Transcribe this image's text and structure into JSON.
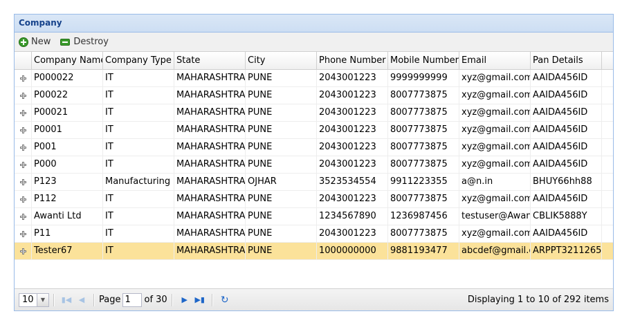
{
  "panel": {
    "title": "Company"
  },
  "toolbar": {
    "new_label": "New",
    "destroy_label": "Destroy"
  },
  "grid": {
    "columns": [
      "Company Name",
      "Company Type",
      "State",
      "City",
      "Phone Number",
      "Mobile Number",
      "Email",
      "Pan Details"
    ],
    "rows": [
      [
        "P000022",
        "IT",
        "MAHARASHTRA",
        "PUNE",
        "2043001223",
        "9999999999",
        "xyz@gmail.com",
        "AAIDA456ID"
      ],
      [
        "P00022",
        "IT",
        "MAHARASHTRA",
        "PUNE",
        "2043001223",
        "8007773875",
        "xyz@gmail.com",
        "AAIDA456ID"
      ],
      [
        "P00021",
        "IT",
        "MAHARASHTRA",
        "PUNE",
        "2043001223",
        "8007773875",
        "xyz@gmail.com",
        "AAIDA456ID"
      ],
      [
        "P0001",
        "IT",
        "MAHARASHTRA",
        "PUNE",
        "2043001223",
        "8007773875",
        "xyz@gmail.com",
        "AAIDA456ID"
      ],
      [
        "P001",
        "IT",
        "MAHARASHTRA",
        "PUNE",
        "2043001223",
        "8007773875",
        "xyz@gmail.com",
        "AAIDA456ID"
      ],
      [
        "P000",
        "IT",
        "MAHARASHTRA",
        "PUNE",
        "2043001223",
        "8007773875",
        "xyz@gmail.com",
        "AAIDA456ID"
      ],
      [
        "P123",
        "Manufacturing",
        "MAHARASHTRA",
        "OJHAR",
        "3523534554",
        "9911223355",
        "a@n.in",
        "BHUY66hh88"
      ],
      [
        "P112",
        "IT",
        "MAHARASHTRA",
        "PUNE",
        "2043001223",
        "8007773875",
        "xyz@gmail.com",
        "AAIDA456ID"
      ],
      [
        "Awanti Ltd",
        "IT",
        "MAHARASHTRA",
        "PUNE",
        "1234567890",
        "1236987456",
        "testuser@Awan",
        "CBLIK5888Y"
      ],
      [
        "P11",
        "IT",
        "MAHARASHTRA",
        "PUNE",
        "2043001223",
        "8007773875",
        "xyz@gmail.com",
        "AAIDA456ID"
      ],
      [
        "Tester67",
        "IT",
        "MAHARASHTRA",
        "PUNE",
        "1000000000",
        "9881193477",
        "abcdef@gmail.c",
        "ARPPT3211265"
      ]
    ],
    "selected_row": 10
  },
  "pager": {
    "page_size": "10",
    "page_label": "Page",
    "page_value": "1",
    "of_label": "of 30",
    "display_text": "Displaying 1 to 10 of 292 items"
  },
  "icons": {
    "new": "add-icon",
    "destroy": "remove-icon",
    "expander": "plus-expander-icon",
    "first": "first-page-icon",
    "prev": "prev-page-icon",
    "next": "next-page-icon",
    "last": "last-page-icon",
    "refresh": "refresh-icon"
  },
  "colors": {
    "header_text": "#15428b",
    "selected_row": "#fbe29a",
    "border": "#99bbe8"
  }
}
